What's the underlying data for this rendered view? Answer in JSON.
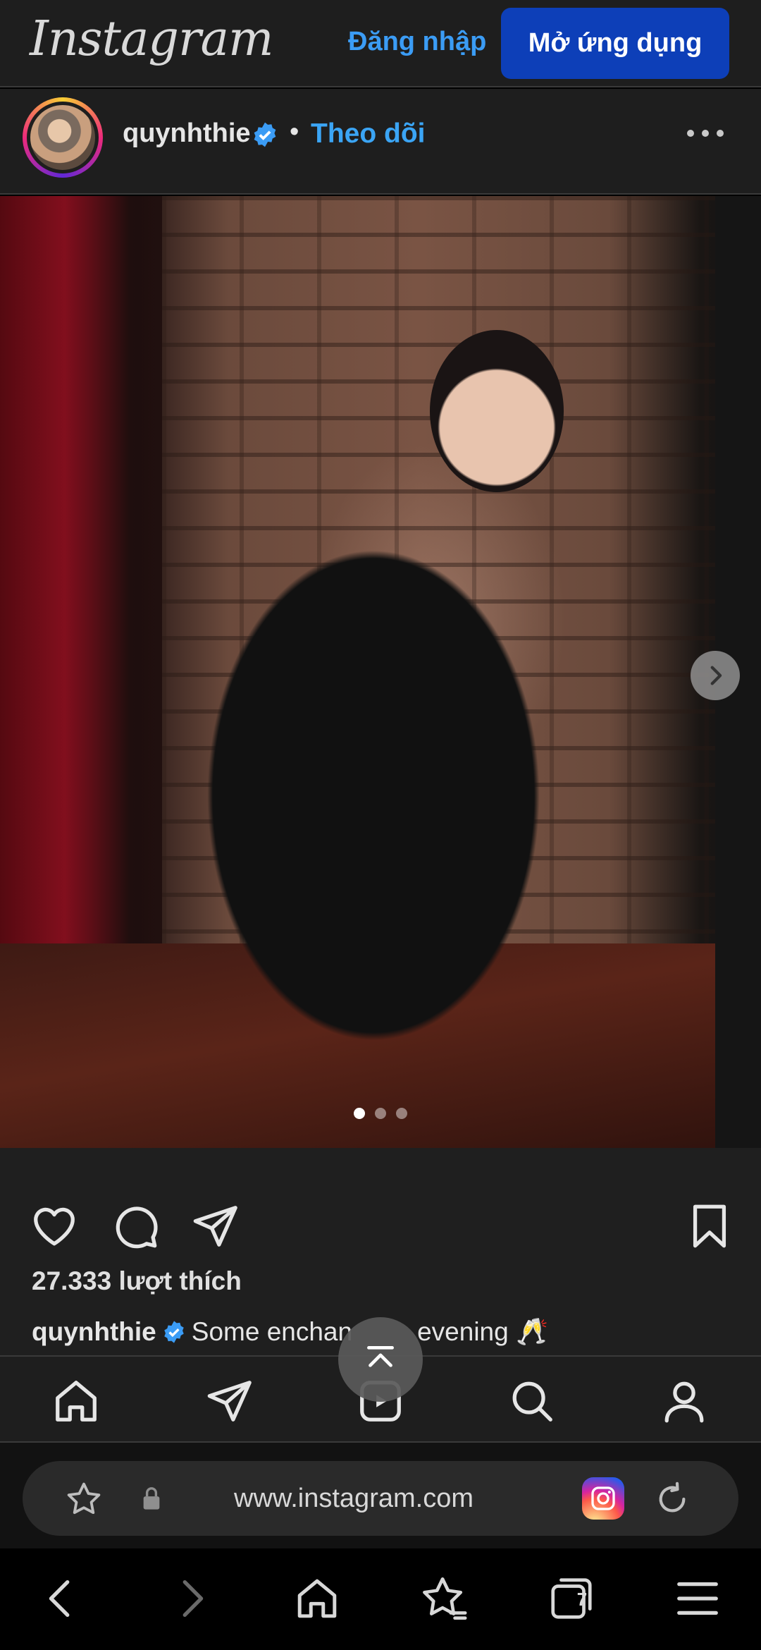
{
  "header": {
    "logo_text": "Instagram",
    "login_label": "Đăng nhập",
    "open_app_label": "Mở ứng dụng"
  },
  "post": {
    "username": "quynhthie",
    "verified": true,
    "separator": "•",
    "follow_label": "Theo dõi",
    "carousel": {
      "current_slide": 1,
      "total_slides": 3
    },
    "likes_text": "27.333 lượt thích",
    "caption_user": "quynhthie",
    "caption_text": "Some enchan",
    "caption_text_after": "evening 🥂"
  },
  "ig_nav": {
    "items": [
      "home-icon",
      "send-icon",
      "reels-icon",
      "search-icon",
      "profile-icon"
    ]
  },
  "browser": {
    "url": "www.instagram.com",
    "tabs_count": "7"
  },
  "colors": {
    "accent_blue": "#3ba5f5",
    "open_app_bg": "#0d3fb8",
    "bar_bg": "#1e1e1e"
  }
}
